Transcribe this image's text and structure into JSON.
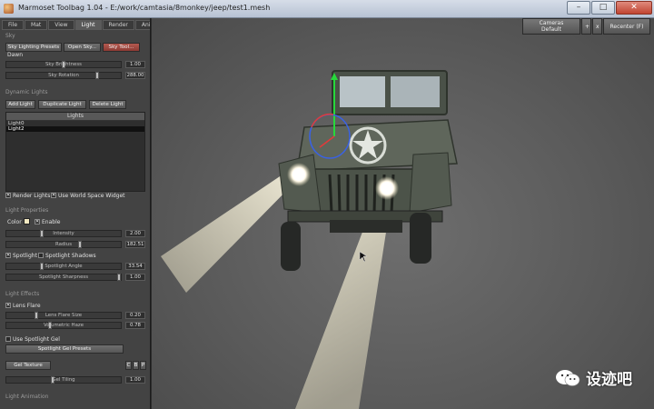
{
  "window": {
    "title": "Marmoset Toolbag 1.04 - E:/work/camtasia/8monkey/jeep/test1.mesh",
    "minimize": "–",
    "maximize": "□",
    "close": "✕"
  },
  "tabs": [
    "File",
    "Mat",
    "View",
    "Light",
    "Render",
    "Anim"
  ],
  "sky": {
    "section": "Sky",
    "presets_button": "Sky Lighting Presets",
    "open_button": "Open Sky...",
    "tool_button": "Sky Tool...",
    "current_preset": "Dawn",
    "brightness_label": "Sky Brightness",
    "brightness_value": "1.00",
    "brightness_level": 0.5,
    "rotation_label": "Sky Rotation",
    "rotation_value": "288.00",
    "rotation_level": 0.8
  },
  "dynamic_lights": {
    "section": "Dynamic Lights",
    "add_button": "Add Light",
    "duplicate_button": "Duplicate Light",
    "delete_button": "Delete Light",
    "list_header": "Lights",
    "items": [
      "Light0",
      "Light2"
    ],
    "selected_index": 1,
    "render_lights_label": "Render Lights",
    "world_space_label": "Use World Space Widget"
  },
  "light_properties": {
    "section": "Light Properties",
    "color_label": "Color",
    "color_swatch": "#f3e9c2",
    "enable_label": "Enable",
    "intensity_label": "Intensity",
    "intensity_value": "2.00",
    "intensity_level": 0.3,
    "radius_label": "Radius",
    "radius_value": "182.51",
    "radius_level": 0.65,
    "spotlight_label": "Spotlight",
    "spotlight_shadows_label": "Spotlight Shadows",
    "spot_angle_label": "Spotlight Angle",
    "spot_angle_value": "33.54",
    "spot_angle_level": 0.3,
    "spot_sharpness_label": "Spotlight Sharpness",
    "spot_sharpness_value": "1.00",
    "spot_sharpness_level": 1.0
  },
  "light_effects": {
    "section": "Light Effects",
    "lens_flare_label": "Lens Flare",
    "flare_size_label": "Lens Flare Size",
    "flare_size_value": "0.20",
    "flare_size_level": 0.25,
    "volumetric_label": "Volumetric Haze",
    "volumetric_value": "0.78",
    "volumetric_level": 0.38,
    "use_gel_label": "Use Spotlight Gel",
    "gel_presets_button": "Spotlight Gel Presets",
    "gel_texture_button": "Gel Texture",
    "gel_channels": [
      "C",
      "B",
      "P"
    ],
    "gel_tiling_label": "Gel Tiling",
    "gel_tiling_value": "1.00",
    "gel_tiling_level": 0.4
  },
  "light_animation": {
    "section": "Light Animation"
  },
  "viewport": {
    "cameras_label": "Cameras",
    "camera_current": "Default",
    "add_label": "+",
    "remove_label": "x",
    "recenter_label": "Recenter (F)"
  },
  "watermark": {
    "text": "设迹吧"
  },
  "colors": {
    "panel": "#434343",
    "viewport": "#5b5b5b",
    "light_beam": "#f3eed8",
    "jeep_body": "#5c6358",
    "gizmo_y": "#27d83b",
    "gizmo_x": "#e23a3a",
    "gizmo_z": "#3a62e2"
  }
}
